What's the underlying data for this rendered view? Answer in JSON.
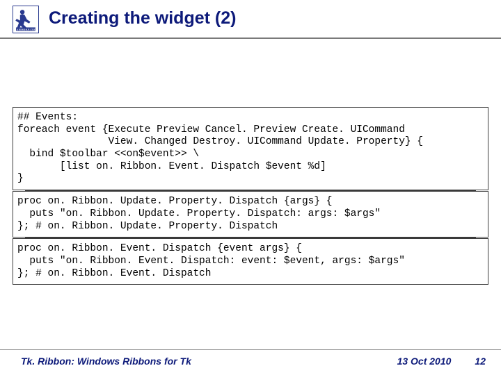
{
  "title": "Creating the widget (2)",
  "code": {
    "block1": "## Events:\nforeach event {Execute Preview Cancel. Preview Create. UICommand\n               View. Changed Destroy. UICommand Update. Property} {\n  bind $toolbar <<on$event>> \\\n       [list on. Ribbon. Event. Dispatch $event %d]\n}",
    "block2": "proc on. Ribbon. Update. Property. Dispatch {args} {\n  puts \"on. Ribbon. Update. Property. Dispatch: args: $args\"\n}; # on. Ribbon. Update. Property. Dispatch",
    "block3": "proc on. Ribbon. Event. Dispatch {event args} {\n  puts \"on. Ribbon. Event. Dispatch: event: $event, args: $args\"\n}; # on. Ribbon. Event. Dispatch"
  },
  "footer": {
    "left": "Tk. Ribbon: Windows Ribbons for Tk",
    "date": "13 Oct 2010",
    "pagenum": "12"
  }
}
